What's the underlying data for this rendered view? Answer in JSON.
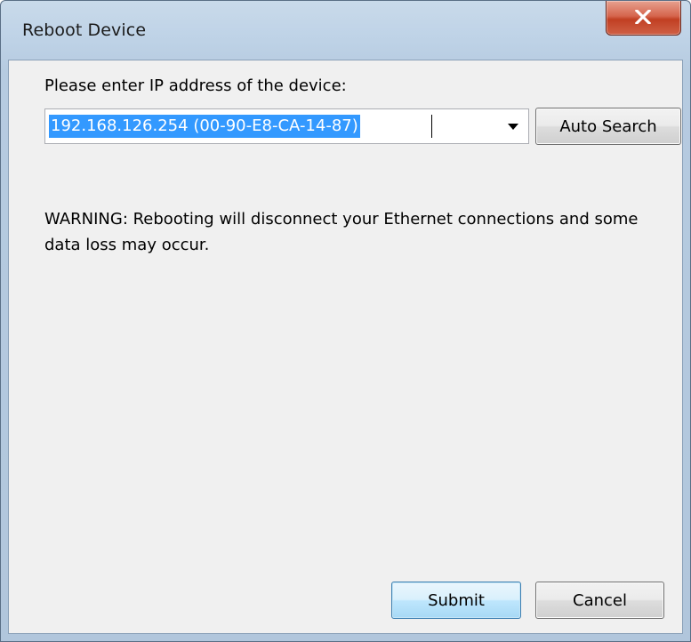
{
  "window": {
    "title": "Reboot Device",
    "close_label": "X"
  },
  "form": {
    "prompt_label": "Please enter IP address of the device:",
    "ip_value": "192.168.126.254 (00-90-E8-CA-14-87)",
    "auto_search_label": "Auto Search",
    "warning_text": "WARNING: Rebooting will disconnect your Ethernet connections and some data loss may occur."
  },
  "buttons": {
    "submit_label": "Submit",
    "cancel_label": "Cancel"
  },
  "colors": {
    "selection": "#3399ff",
    "close_button": "#c8452a",
    "frame": "#bfd3e7"
  }
}
